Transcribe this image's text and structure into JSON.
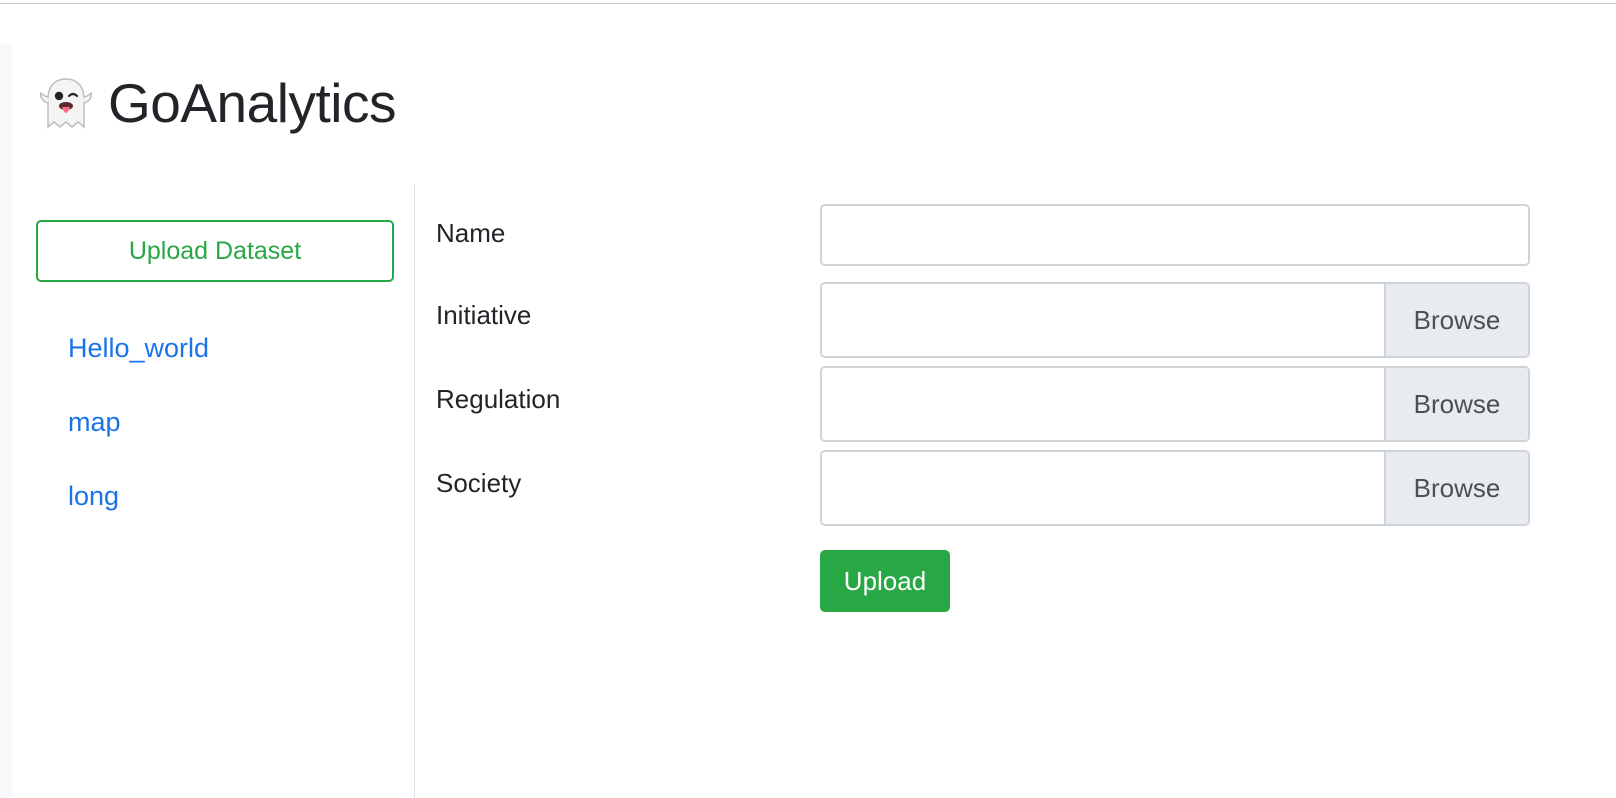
{
  "app": {
    "title": "GoAnalytics",
    "logo_icon": "ghost-icon"
  },
  "sidebar": {
    "upload_dataset_label": "Upload Dataset",
    "datasets": [
      {
        "label": "Hello_world"
      },
      {
        "label": "map"
      },
      {
        "label": "long"
      }
    ]
  },
  "form": {
    "name_label": "Name",
    "name_value": "",
    "initiative_label": "Initiative",
    "regulation_label": "Regulation",
    "society_label": "Society",
    "browse_label": "Browse",
    "upload_label": "Upload"
  },
  "colors": {
    "accent_green": "#28a745",
    "link_blue": "#1a73e8",
    "text": "#212529",
    "border": "#ced4da"
  }
}
